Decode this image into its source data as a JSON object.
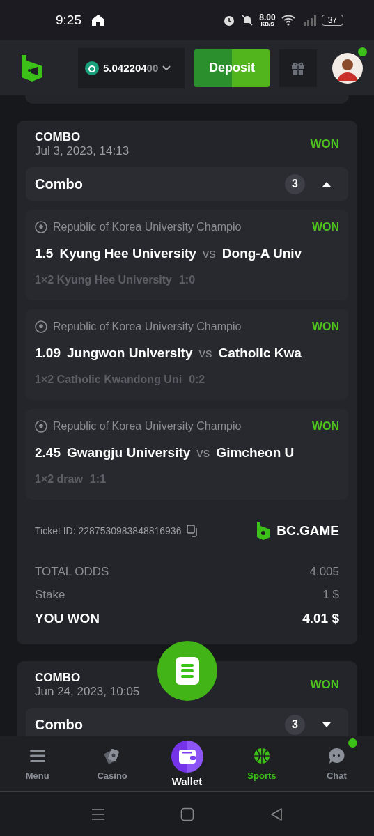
{
  "status_bar": {
    "time": "9:25",
    "speed": "8.00",
    "speed_unit": "KB/S",
    "battery": "37"
  },
  "header": {
    "balance": {
      "value": "5.042204",
      "dim_digits": "00"
    },
    "deposit": "Deposit",
    "avatar_badge": true
  },
  "bets": [
    {
      "type": "COMBO",
      "date": "Jul 3, 2023, 14:13",
      "status": "WON",
      "group": {
        "label": "Combo",
        "count": "3",
        "expanded": true
      },
      "selections": [
        {
          "league": "Republic of Korea University Champio",
          "status": "WON",
          "odds": "1.5",
          "home": "Kyung Hee University",
          "vs": "vs",
          "away": "Dong-A Univ",
          "market": "1×2 Kyung Hee University",
          "score": "1:0"
        },
        {
          "league": "Republic of Korea University Champio",
          "status": "WON",
          "odds": "1.09",
          "home": "Jungwon University",
          "vs": "vs",
          "away": "Catholic Kwa",
          "market": "1×2 Catholic Kwandong Uni",
          "score": "0:2"
        },
        {
          "league": "Republic of Korea University Champio",
          "status": "WON",
          "odds": "2.45",
          "home": "Gwangju University",
          "vs": "vs",
          "away": "Gimcheon U",
          "market": "1×2 draw",
          "score": "1:1"
        }
      ],
      "ticket": "Ticket ID: 2287530983848816936",
      "brand": "BC.GAME",
      "totals": [
        {
          "label": "TOTAL ODDS",
          "value": "4.005",
          "kind": "plain"
        },
        {
          "label": "Stake",
          "value": "1 $",
          "kind": "plain"
        },
        {
          "label": "YOU WON",
          "value": "4.01 $",
          "kind": "strong"
        }
      ]
    },
    {
      "type": "COMBO",
      "date": "Jun 24, 2023, 10:05",
      "status": "WON",
      "group": {
        "label": "Combo",
        "count": "3",
        "expanded": false
      }
    }
  ],
  "nav": [
    {
      "label": "Menu",
      "kind": "menu",
      "selected": false,
      "badge": false
    },
    {
      "label": "Casino",
      "kind": "casino",
      "selected": false,
      "badge": false
    },
    {
      "label": "Wallet",
      "kind": "wallet",
      "selected": false,
      "badge": false
    },
    {
      "label": "Sports",
      "kind": "sports",
      "selected": true,
      "badge": false
    },
    {
      "label": "Chat",
      "kind": "chat",
      "selected": false,
      "badge": true
    }
  ]
}
